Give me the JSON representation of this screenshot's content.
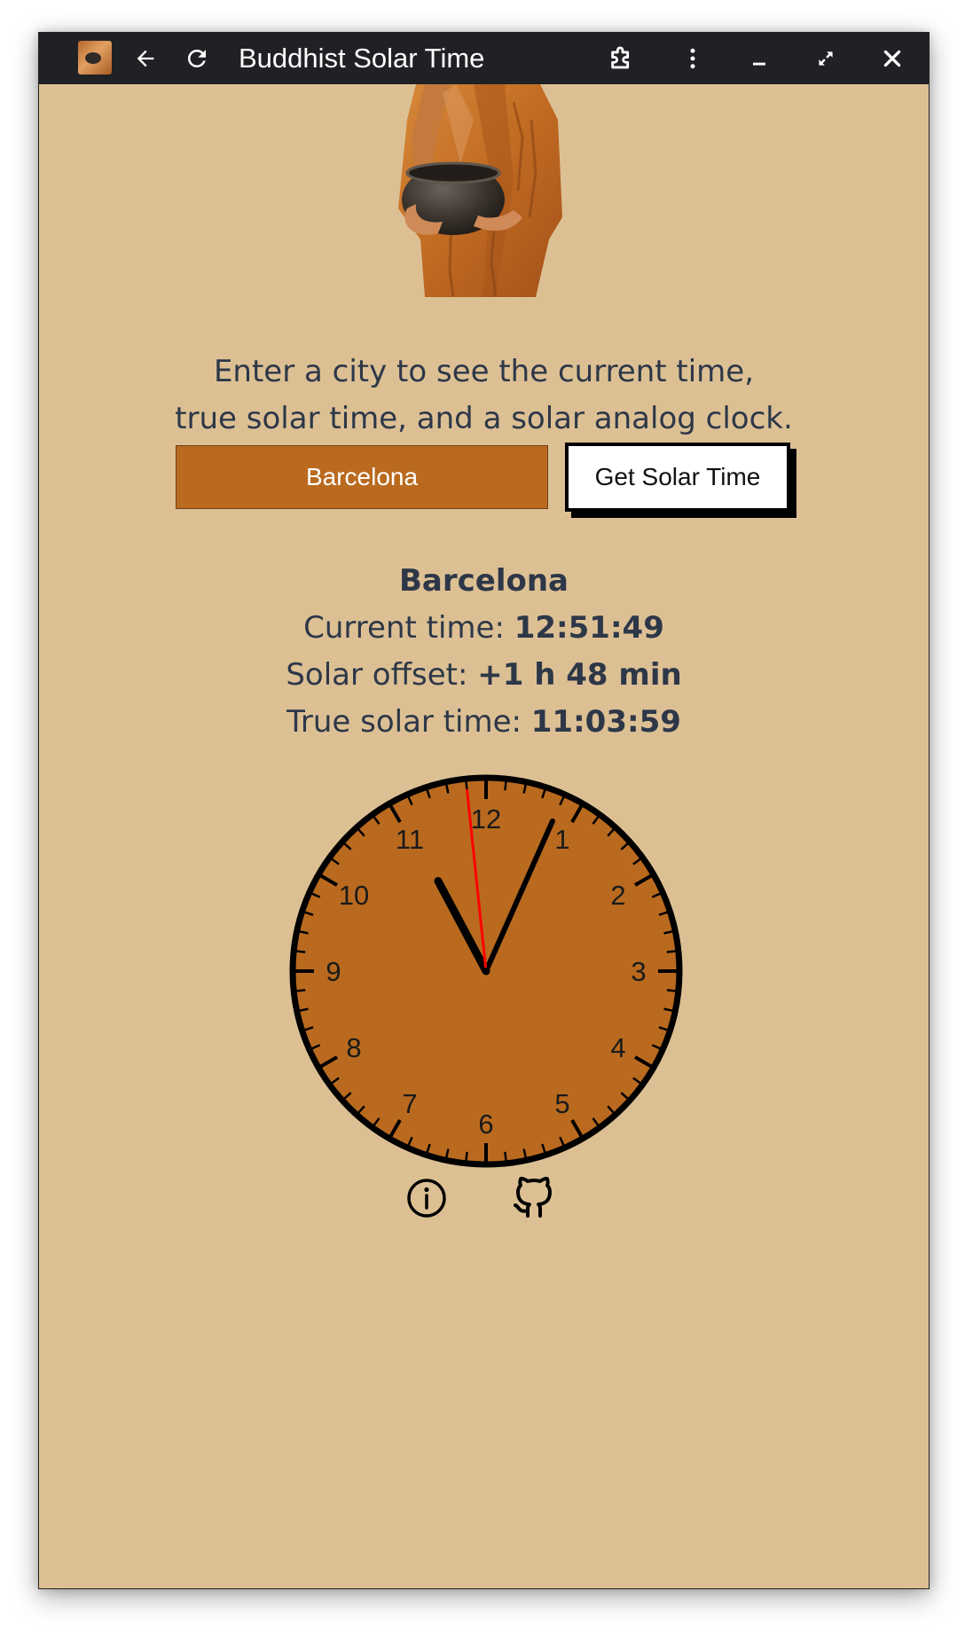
{
  "window": {
    "title": "Buddhist Solar Time"
  },
  "intro": {
    "line1": "Enter a city to see the current time,",
    "line2": "true solar time, and a solar analog clock."
  },
  "form": {
    "city_value": "Barcelona",
    "button_label": "Get Solar Time"
  },
  "result": {
    "city": "Barcelona",
    "current_label": "Current time: ",
    "current_value": "12:51:49",
    "offset_label": "Solar offset: ",
    "offset_value": "+1 h 48 min",
    "solar_label": "True solar time: ",
    "solar_value": "11:03:59"
  },
  "clock": {
    "numbers": [
      "12",
      "1",
      "2",
      "3",
      "4",
      "5",
      "6",
      "7",
      "8",
      "9",
      "10",
      "11"
    ],
    "time": {
      "hours": 11,
      "minutes": 3,
      "seconds": 59
    },
    "face_color": "#b96a1f",
    "hand_color": "#000000",
    "second_hand_color": "#ff0000"
  },
  "colors": {
    "background": "#dcc094",
    "text": "#2d3748",
    "accent": "#b96a1f"
  },
  "icons": {
    "info": "info-icon",
    "github": "github-icon"
  }
}
